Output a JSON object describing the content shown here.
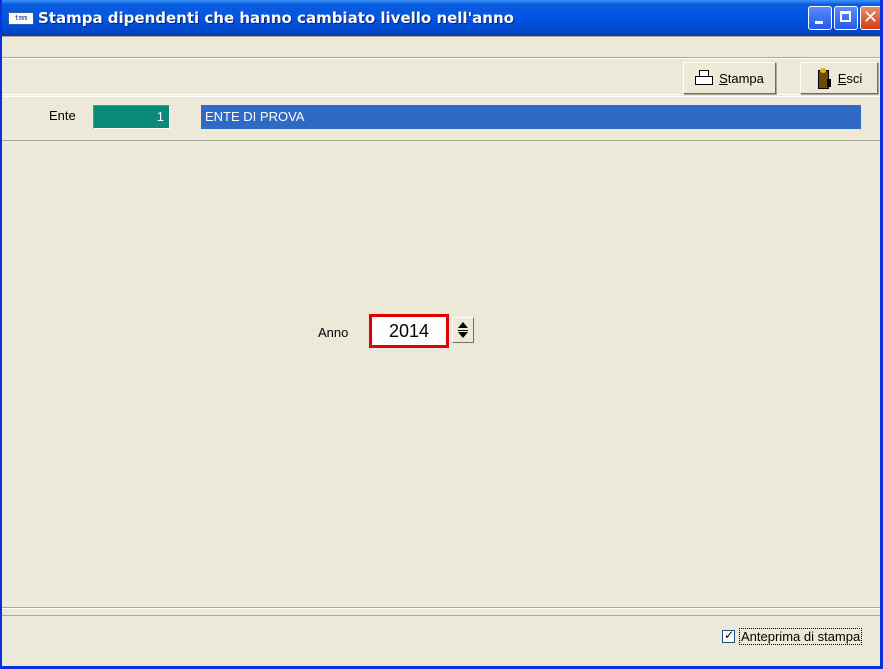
{
  "window": {
    "title": "Stampa dipendenti che hanno cambiato livello nell'anno",
    "icon_text": "tmm",
    "controls": {
      "minimize": "minimize-icon",
      "maximize": "maximize-icon",
      "close_glyph": "✕"
    }
  },
  "toolbar": {
    "stampa_label": "Stampa",
    "esci_label": "Esci",
    "stampa_icon": "printer-icon",
    "esci_icon": "exit-door-icon"
  },
  "ente": {
    "label": "Ente",
    "code": "1",
    "name": "ENTE DI PROVA"
  },
  "anno": {
    "label": "Anno",
    "value": "2014"
  },
  "status": {
    "anteprima_label": "Anteprima di stampa",
    "anteprima_checked": true,
    "check_glyph": "✓"
  },
  "colors": {
    "title_bar": "#0055e5",
    "ente_code_bg": "#0a8a7a",
    "ente_name_bg": "#316ac5",
    "highlight_border": "#e00000",
    "window_bg": "#ece9d8"
  }
}
